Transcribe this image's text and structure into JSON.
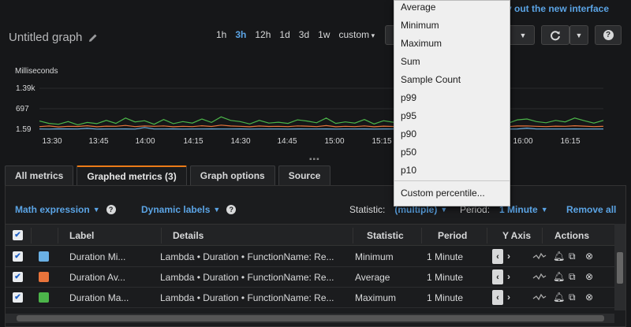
{
  "notice": "y out the new interface",
  "graph": {
    "title": "Untitled graph",
    "unit": "Milliseconds",
    "yticks": [
      "1.39k",
      "697",
      "1.59"
    ],
    "xticks": [
      "13:30",
      "13:45",
      "14:00",
      "14:15",
      "14:30",
      "14:45",
      "15:00",
      "15:15",
      "16:00",
      "16:15"
    ]
  },
  "ranges": [
    "1h",
    "3h",
    "12h",
    "1d",
    "3d",
    "1w",
    "custom"
  ],
  "active_range": "3h",
  "tabs": [
    "All metrics",
    "Graphed metrics (3)",
    "Graph options",
    "Source"
  ],
  "toolbar": {
    "math": "Math expression",
    "dynamic": "Dynamic labels",
    "statistic_label": "Statistic:",
    "statistic_value": "(multiple)",
    "period_label": "Period:",
    "period_value": "1 Minute",
    "remove_all": "Remove all"
  },
  "columns": [
    "Label",
    "Details",
    "Statistic",
    "Period",
    "Y Axis",
    "Actions"
  ],
  "rows": [
    {
      "label": "Duration Mi...",
      "details": "Lambda • Duration • FunctionName: Re...",
      "statistic": "Minimum",
      "period": "1 Minute",
      "color": "#6ab0e4"
    },
    {
      "label": "Duration Av...",
      "details": "Lambda • Duration • FunctionName: Re...",
      "statistic": "Average",
      "period": "1 Minute",
      "color": "#e8743b"
    },
    {
      "label": "Duration Ma...",
      "details": "Lambda • Duration • FunctionName: Re...",
      "statistic": "Maximum",
      "period": "1 Minute",
      "color": "#4cb54a"
    }
  ],
  "statistic_menu": [
    "Average",
    "Minimum",
    "Maximum",
    "Sum",
    "Sample Count",
    "p99",
    "p95",
    "p90",
    "p50",
    "p10",
    "Custom percentile..."
  ],
  "chart_data": {
    "type": "line",
    "ylabel": "Milliseconds",
    "yticks": [
      "1.39k",
      "697",
      "1.59"
    ],
    "ylim": [
      1.59,
      1390
    ],
    "series": [
      {
        "name": "Duration Ma...",
        "color": "#4cb54a",
        "values": [
          280,
          200,
          170,
          260,
          150,
          230,
          190,
          300,
          200,
          380,
          250,
          290,
          170,
          330,
          190,
          260,
          210,
          350,
          230,
          420,
          300,
          260,
          180,
          300,
          210,
          240,
          200,
          320,
          280,
          220,
          380,
          200,
          250,
          210,
          330,
          180,
          290,
          240,
          170,
          290,
          210,
          310,
          190,
          260,
          240,
          180,
          1390,
          300,
          270,
          200,
          320,
          350,
          260,
          220,
          300,
          250,
          380,
          290,
          210,
          300
        ]
      },
      {
        "name": "Duration Av...",
        "color": "#e8743b",
        "values": [
          90,
          110,
          80,
          100,
          95,
          120,
          85,
          105,
          100,
          130,
          90,
          110,
          100,
          115,
          85,
          100,
          90,
          120,
          95,
          140,
          110,
          100,
          85,
          110,
          95,
          100,
          90,
          115,
          105,
          90,
          125,
          85,
          100,
          90,
          115,
          85,
          105,
          95,
          80,
          100,
          90,
          110,
          85,
          100,
          95,
          80,
          160,
          105,
          100,
          90,
          110,
          115,
          100,
          90,
          105,
          100,
          120,
          105,
          90,
          100
        ]
      },
      {
        "name": "Duration Mi...",
        "color": "#6ab0e4",
        "values": [
          10,
          8,
          15,
          12,
          9,
          30,
          8,
          10,
          9,
          12,
          8,
          60,
          10,
          9,
          11,
          8,
          10,
          9,
          12,
          10,
          9,
          11,
          8,
          10,
          9,
          10,
          8,
          11,
          10,
          9,
          12,
          8,
          10,
          9,
          11,
          8,
          10,
          9,
          8,
          10,
          9,
          11,
          8,
          10,
          9,
          8,
          12,
          10,
          9,
          8,
          10,
          40,
          10,
          9,
          10,
          9,
          12,
          10,
          9,
          10
        ]
      }
    ],
    "xticks": [
      "13:30",
      "13:45",
      "14:00",
      "14:15",
      "14:30",
      "14:45",
      "15:00",
      "15:15",
      "16:00",
      "16:15"
    ],
    "grid": true
  }
}
